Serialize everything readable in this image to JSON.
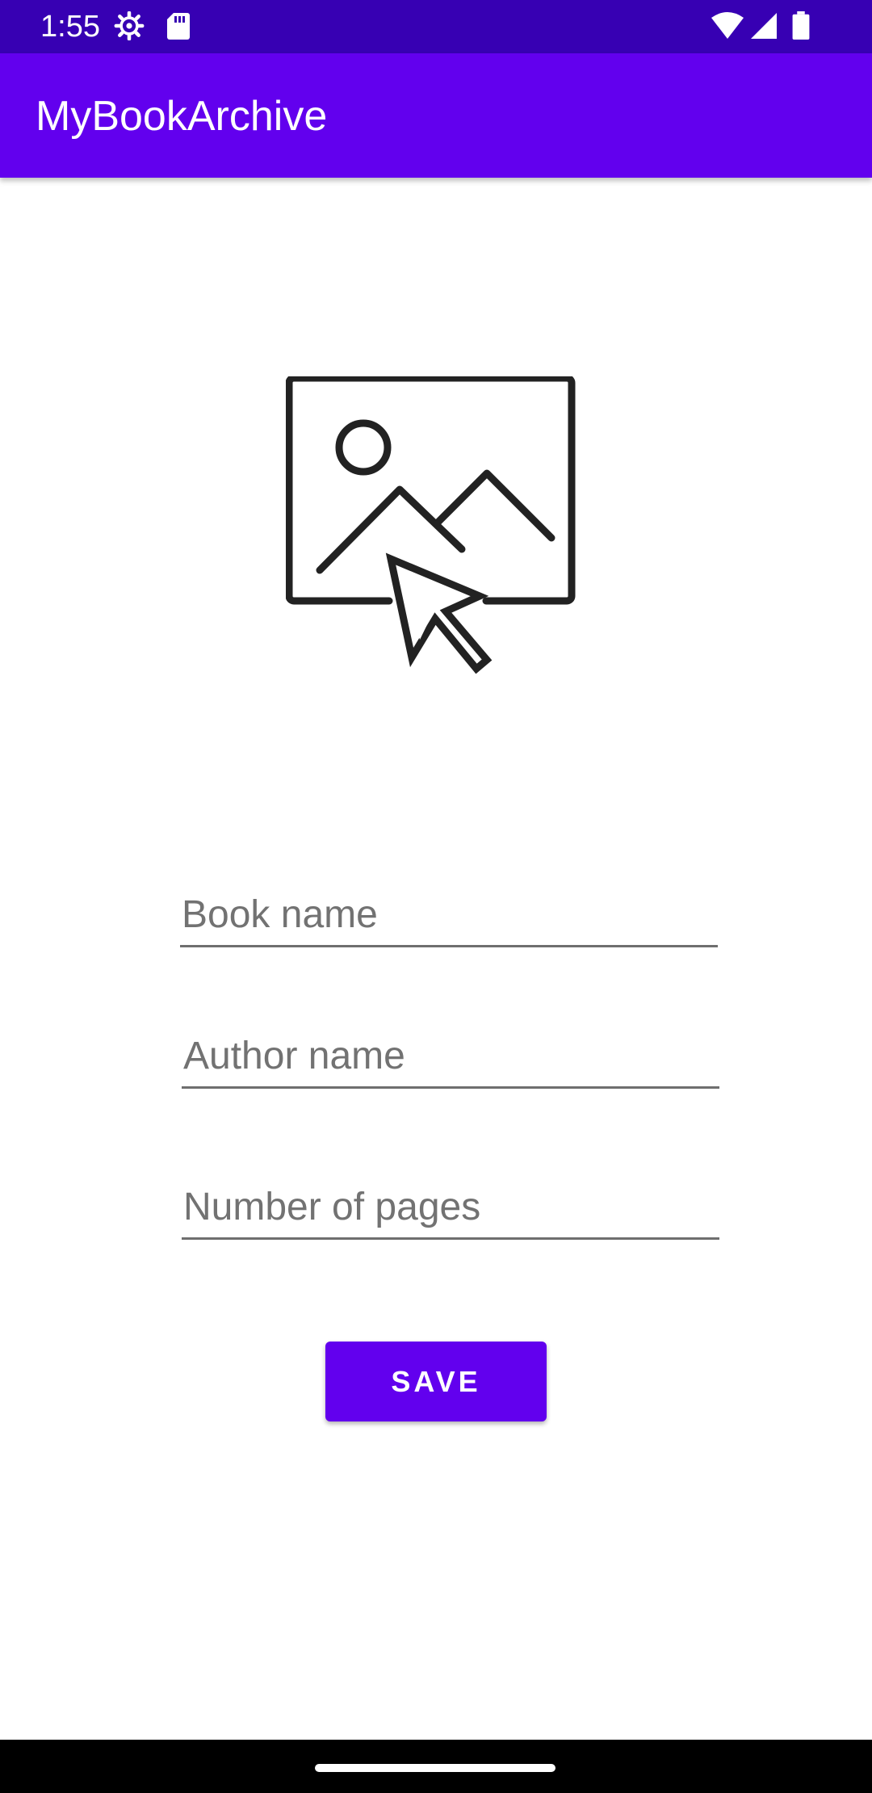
{
  "status_bar": {
    "time": "1:55",
    "icons": [
      "settings-icon",
      "sd-card-icon",
      "wifi-icon",
      "signal-icon",
      "battery-icon"
    ]
  },
  "app_bar": {
    "title": "MyBookArchive"
  },
  "image_picker": {
    "icon": "select-image-icon"
  },
  "form": {
    "book_name_placeholder": "Book name",
    "book_name_value": "",
    "author_name_placeholder": "Author name",
    "author_name_value": "",
    "pages_placeholder": "Number of pages",
    "pages_value": ""
  },
  "save_button": {
    "label": "SAVE"
  },
  "colors": {
    "primary": "#6200EE",
    "primary_dark": "#3700B3",
    "on_primary": "#FFFFFF"
  }
}
